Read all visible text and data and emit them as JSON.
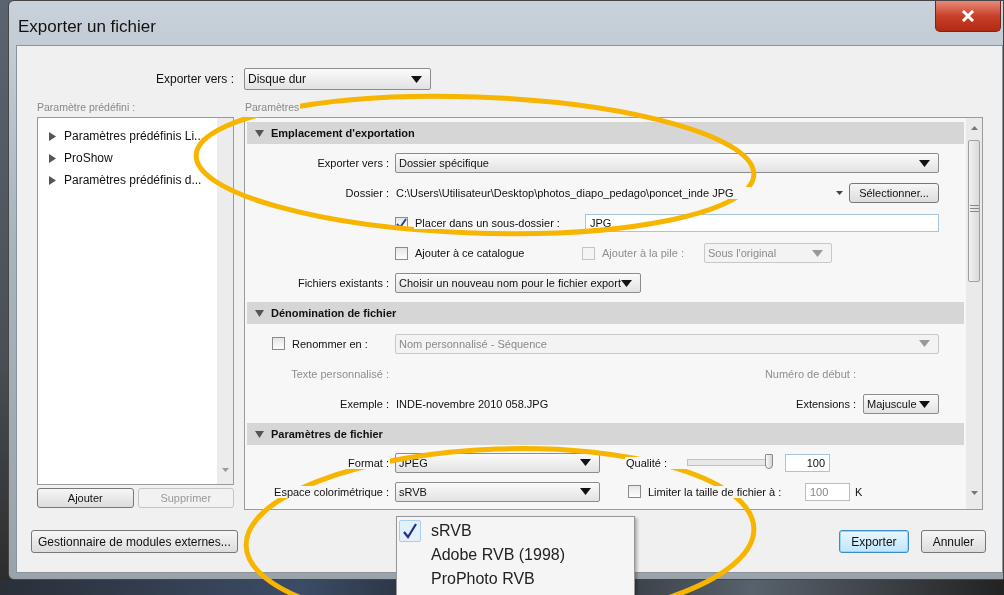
{
  "window": {
    "title": "Exporter un fichier"
  },
  "export_to": {
    "label": "Exporter vers :",
    "value": "Disque dur"
  },
  "presets": {
    "label": "Paramètre prédéfini :",
    "items": [
      {
        "label": "Paramètres prédéfinis Li...",
        "expanded": false
      },
      {
        "label": "ProShow",
        "expanded": false
      },
      {
        "label": "Paramètres prédéfinis d...",
        "expanded": false
      }
    ],
    "buttons": [
      {
        "label": "Ajouter",
        "disabled": false
      },
      {
        "label": "Supprimer",
        "disabled": true
      }
    ]
  },
  "settings": {
    "label": "Paramètres",
    "sections": [
      {
        "title": "Emplacement d'exportation",
        "expanded": true,
        "rows": [
          {
            "label": "Exporter vers :",
            "controls": [
              {
                "kind": "dropdown",
                "value": "Dossier spécifique",
                "disabled": false
              }
            ]
          },
          {
            "label": "Dossier :",
            "controls": [
              {
                "kind": "text",
                "text": "C:\\Users\\Utilisateur\\Desktop\\photos_diapo_pedago\\poncet_inde JPG",
                "muted": false
              },
              {
                "kind": "caret"
              },
              {
                "kind": "button",
                "label": "Sélectionner..."
              }
            ]
          },
          {
            "controls": [
              {
                "kind": "checkbox",
                "label": "Placer dans un sous-dossier :",
                "checked": true,
                "disabled": false
              },
              {
                "kind": "field",
                "value": "JPG"
              }
            ]
          },
          {
            "controls": [
              {
                "kind": "checkbox",
                "label": "Ajouter à ce catalogue",
                "checked": false,
                "disabled": false
              },
              {
                "kind": "checkbox",
                "label": "Ajouter à la pile :",
                "checked": false,
                "disabled": true
              },
              {
                "kind": "dropdown",
                "value": "Sous l'original",
                "disabled": true
              }
            ]
          },
          {
            "label": "Fichiers existants :",
            "controls": [
              {
                "kind": "dropdown",
                "value": "Choisir un nouveau nom pour le fichier export",
                "disabled": false
              }
            ]
          }
        ]
      },
      {
        "title": "Dénomination de fichier",
        "expanded": true,
        "rows": [
          {
            "check": {
              "label": "Renommer en :",
              "checked": false
            },
            "controls": [
              {
                "kind": "dropdown",
                "value": "Nom personnalisé - Séquence",
                "disabled": true
              }
            ]
          },
          {
            "label": "Texte personnalisé :",
            "muted": true,
            "controls": [
              {
                "kind": "text",
                "text": "Numéro de début :",
                "muted": true
              }
            ]
          },
          {
            "label": "Exemple :",
            "controls": [
              {
                "kind": "text",
                "text": "INDE-novembre 2010 058.JPG",
                "muted": false
              },
              {
                "kind": "text",
                "text": "Extensions :",
                "muted": false
              },
              {
                "kind": "dropdown",
                "value": "Majuscule",
                "disabled": false
              }
            ]
          }
        ]
      },
      {
        "title": "Paramètres de fichier",
        "expanded": true,
        "rows": [
          {
            "label": "Format :",
            "controls": [
              {
                "kind": "dropdown",
                "value": "JPEG",
                "disabled": false
              },
              {
                "kind": "text",
                "text": "Qualité :",
                "muted": false
              },
              {
                "kind": "slider",
                "level": 1.0
              },
              {
                "kind": "field",
                "value": "100"
              }
            ]
          },
          {
            "label": "Espace colorimétrique :",
            "controls": [
              {
                "kind": "dropdown",
                "value": "sRVB",
                "disabled": false
              },
              {
                "kind": "checkbox",
                "label": "Limiter la taille de fichier à :",
                "checked": false,
                "disabled": false
              },
              {
                "kind": "field",
                "value": "100",
                "disabled": true
              },
              {
                "kind": "text",
                "text": "K",
                "muted": false
              }
            ]
          }
        ]
      }
    ]
  },
  "footer": {
    "plugin_button": "Gestionnaire de modules externes...",
    "buttons": [
      {
        "label": "Exporter",
        "default": true
      },
      {
        "label": "Annuler",
        "default": false
      }
    ]
  },
  "menu": {
    "items": [
      {
        "label": "sRVB",
        "checked": true
      },
      {
        "label": "Adobe RVB (1998)",
        "checked": false
      },
      {
        "label": "ProPhoto RVB",
        "checked": false
      }
    ]
  },
  "annotations": [
    {
      "kind": "ellipse"
    },
    {
      "kind": "ellipse"
    }
  ]
}
